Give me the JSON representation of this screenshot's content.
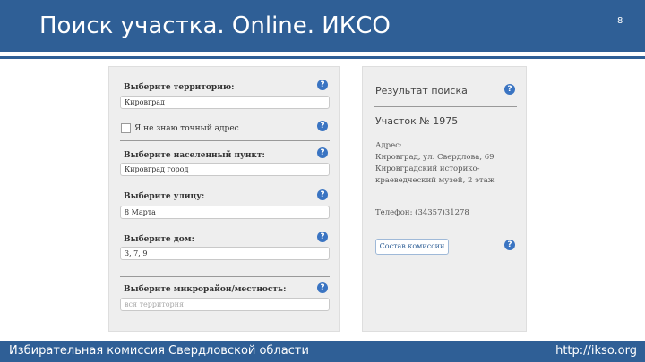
{
  "slide": {
    "title": "Поиск участка. Online. ИКСО",
    "number": "8",
    "footer_left": "Избирательная комиссия Свердловской области",
    "footer_right": "http://ikso.org"
  },
  "search_form": {
    "territory_label": "Выберите территорию:",
    "territory_value": "Кировград",
    "unknown_address_label": "Я не знаю точный адрес",
    "locality_label": "Выберите населенный пункт:",
    "locality_value": "Кировград город",
    "street_label": "Выберите улицу:",
    "street_value": "8 Марта",
    "house_label": "Выберите дом:",
    "house_value": "3, 7, 9",
    "district_label": "Выберите микрорайон/местность:",
    "district_placeholder": "вся территория",
    "help_glyph": "?"
  },
  "result": {
    "title": "Результат поиска",
    "district": "Участок № 1975",
    "address_label": "Адрес:",
    "address_lines": [
      "Кировград, ул. Свердлова, 69",
      "Кировградский историко-",
      "краеведческий музей, 2 этаж"
    ],
    "phone": "Телефон: (34357)31278",
    "commission_button": "Состав комиссии"
  },
  "colors": {
    "brand": "#2f5f96",
    "help_icon": "#3a74c2",
    "panel_bg": "#eeeeee"
  }
}
